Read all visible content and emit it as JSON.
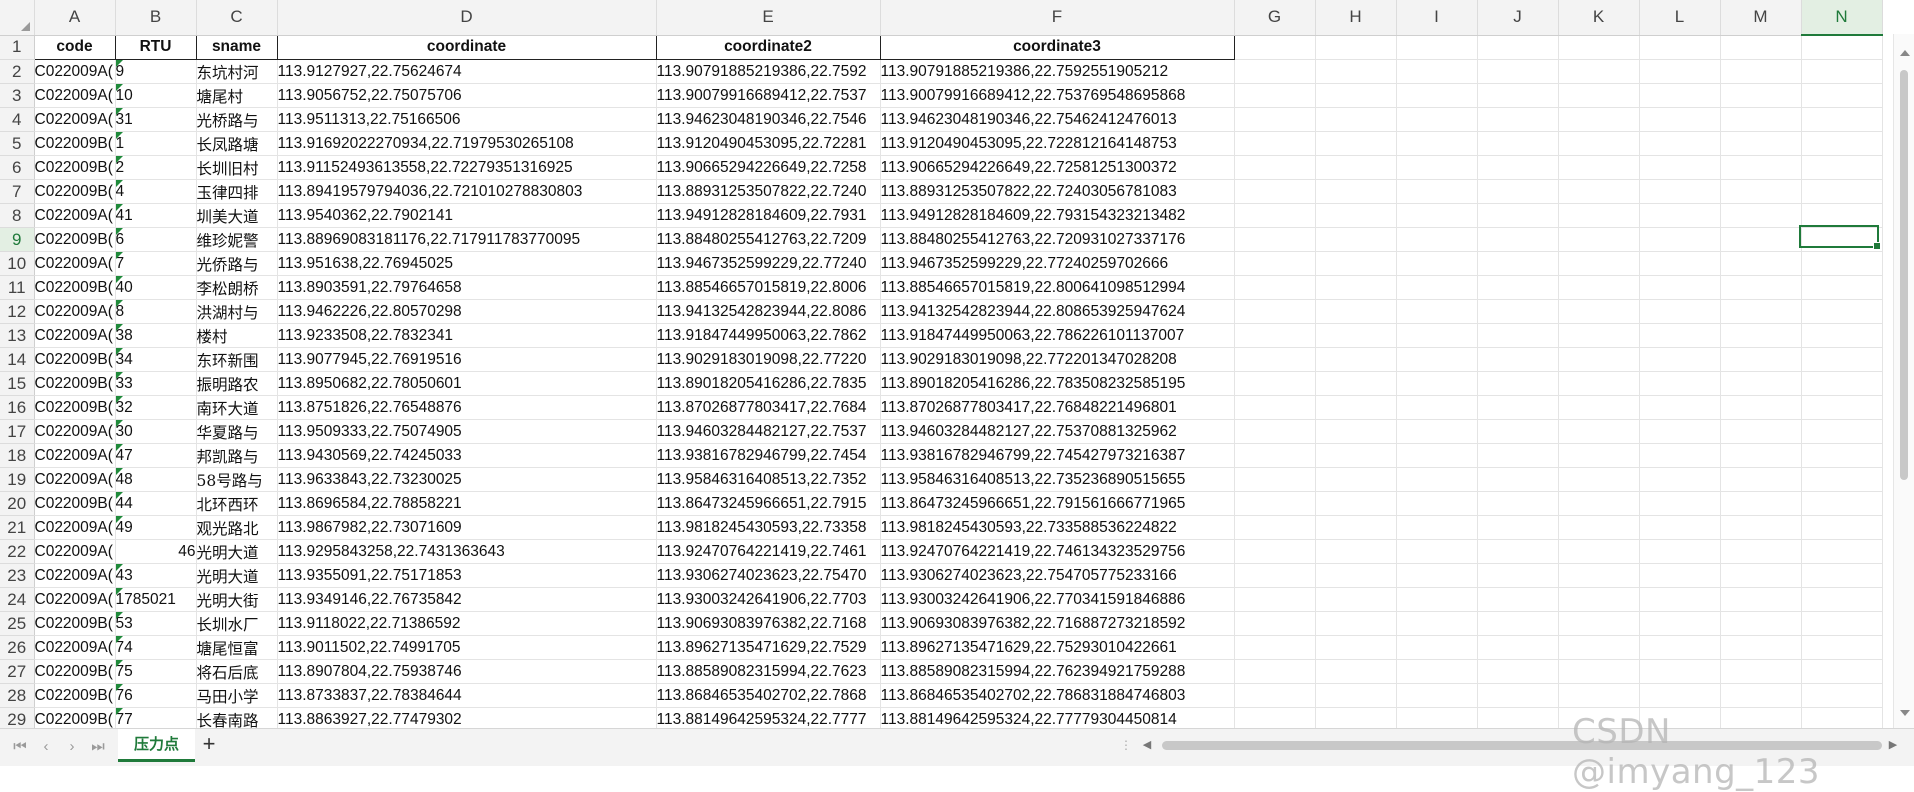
{
  "columns": [
    "A",
    "B",
    "C",
    "D",
    "E",
    "F",
    "G",
    "H",
    "I",
    "J",
    "K",
    "L",
    "M",
    "N"
  ],
  "selected_column": "N",
  "selected_row": "9",
  "header_row": {
    "row": "1",
    "cells": [
      "code",
      "RTU",
      "sname",
      "coordinate",
      "coordinate2",
      "coordinate3"
    ]
  },
  "rows": [
    {
      "row": "2",
      "a": "C022009A(",
      "b": "9",
      "c": "东坑村河",
      "d": "113.9127927,22.75624674",
      "e": "113.90791885219386,22.7592",
      "f": "113.90791885219386,22.7592551905212"
    },
    {
      "row": "3",
      "a": "C022009A(",
      "b": "10",
      "c": "塘尾村",
      "d": "113.9056752,22.75075706",
      "e": "113.90079916689412,22.7537",
      "f": "113.90079916689412,22.753769548695868"
    },
    {
      "row": "4",
      "a": "C022009A(",
      "b": "31",
      "c": "光桥路与",
      "d": "113.9511313,22.75166506",
      "e": "113.94623048190346,22.7546",
      "f": "113.94623048190346,22.75462412476013"
    },
    {
      "row": "5",
      "a": "C022009B(",
      "b": "1",
      "c": "长凤路塘",
      "d": "113.91692022270934,22.71979530265108",
      "e": "113.9120490453095,22.72281",
      "f": "113.9120490453095,22.722812164148753"
    },
    {
      "row": "6",
      "a": "C022009B(",
      "b": "2",
      "c": "长圳旧村",
      "d": "113.91152493613558,22.72279351316925",
      "e": "113.90665294226649,22.7258",
      "f": "113.90665294226649,22.72581251300372"
    },
    {
      "row": "7",
      "a": "C022009B(",
      "b": "4",
      "c": "玉律四排",
      "d": "113.89419579794036,22.721010278830803",
      "e": "113.88931253507822,22.7240",
      "f": "113.88931253507822,22.72403056781083"
    },
    {
      "row": "8",
      "a": "C022009A(",
      "b": "41",
      "c": "圳美大道",
      "d": "113.9540362,22.7902141",
      "e": "113.94912828184609,22.7931",
      "f": "113.94912828184609,22.793154323213482"
    },
    {
      "row": "9",
      "a": "C022009B(",
      "b": "6",
      "c": "维珍妮警",
      "d": "113.88969083181176,22.717911783770095",
      "e": "113.88480255412763,22.7209",
      "f": "113.88480255412763,22.720931027337176"
    },
    {
      "row": "10",
      "a": "C022009A(",
      "b": "7",
      "c": "光侨路与",
      "d": "113.951638,22.76945025",
      "e": "113.9467352599229,22.77240",
      "f": "113.9467352599229,22.77240259702666"
    },
    {
      "row": "11",
      "a": "C022009B(",
      "b": "40",
      "c": "李松朗桥",
      "d": "113.8903591,22.79764658",
      "e": "113.88546657015819,22.8006",
      "f": "113.88546657015819,22.800641098512994"
    },
    {
      "row": "12",
      "a": "C022009A(",
      "b": "8",
      "c": "洪湖村与",
      "d": "113.9462226,22.80570298",
      "e": "113.94132542823944,22.8086",
      "f": "113.94132542823944,22.808653925947624"
    },
    {
      "row": "13",
      "a": "C022009A(",
      "b": "38",
      "c": "楼村",
      "d": "113.9233508,22.7832341",
      "e": "113.91847449950063,22.7862",
      "f": "113.91847449950063,22.786226101137007"
    },
    {
      "row": "14",
      "a": "C022009B(",
      "b": "34",
      "c": "东环新围",
      "d": "113.9077945,22.76919516",
      "e": "113.9029183019098,22.77220",
      "f": "113.9029183019098,22.772201347028208"
    },
    {
      "row": "15",
      "a": "C022009B(",
      "b": "33",
      "c": "振明路农",
      "d": "113.8950682,22.78050601",
      "e": "113.89018205416286,22.7835",
      "f": "113.89018205416286,22.783508232585195"
    },
    {
      "row": "16",
      "a": "C022009B(",
      "b": "32",
      "c": "南环大道",
      "d": "113.8751826,22.76548876",
      "e": "113.87026877803417,22.7684",
      "f": "113.87026877803417,22.76848221496801"
    },
    {
      "row": "17",
      "a": "C022009A(",
      "b": "30",
      "c": "华夏路与",
      "d": "113.9509333,22.75074905",
      "e": "113.94603284482127,22.7537",
      "f": "113.94603284482127,22.75370881325962"
    },
    {
      "row": "18",
      "a": "C022009A(",
      "b": "47",
      "c": "邦凯路与",
      "d": "113.9430569,22.74245033",
      "e": "113.93816782946799,22.7454",
      "f": "113.93816782946799,22.745427973216387"
    },
    {
      "row": "19",
      "a": "C022009A(",
      "b": "48",
      "c": "58号路与",
      "d": "113.9633843,22.73230025",
      "e": "113.95846316408513,22.7352",
      "f": "113.95846316408513,22.735236890515655"
    },
    {
      "row": "20",
      "a": "C022009B(",
      "b": "44",
      "c": "北环西环",
      "d": "113.8696584,22.78858221",
      "e": "113.86473245966651,22.7915",
      "f": "113.86473245966651,22.79156166677196​5"
    },
    {
      "row": "21",
      "a": "C022009A(",
      "b": "49",
      "c": "观光路北",
      "d": "113.9867982,22.73071609",
      "e": "113.9818245430593,22.73358",
      "f": "113.9818245430593,22.733588536224822"
    },
    {
      "row": "22",
      "a": "C022009A(",
      "b": "46",
      "c": "光明大道",
      "d": "113.9295843258,22.7431363643",
      "e": "113.92470764221419,22.7461",
      "f": "113.92470764221419,22.746134323529756"
    },
    {
      "row": "23",
      "a": "C022009A(",
      "b": "43",
      "c": "光明大道",
      "d": "113.9355091,22.75171853",
      "e": "113.9306274023623,22.75470",
      "f": "113.9306274023623,22.754705775233166"
    },
    {
      "row": "24",
      "a": "C022009A(",
      "b": "1785021",
      "c": "光明大街",
      "d": "113.9349146,22.76735842",
      "e": "113.93003242641906,22.7703",
      "f": "113.93003242641906,22.770341591846886"
    },
    {
      "row": "25",
      "a": "C022009B(",
      "b": "53",
      "c": "长圳水厂",
      "d": "113.9118022,22.71386592",
      "e": "113.90693083976382,22.7168",
      "f": "113.90693083976382,22.716887273218592"
    },
    {
      "row": "26",
      "a": "C022009A(",
      "b": "74",
      "c": "塘尾恒富",
      "d": "113.9011502,22.74991705",
      "e": "113.89627135471629,22.7529",
      "f": "113.89627135471629,22.75293010422661"
    },
    {
      "row": "27",
      "a": "C022009B(",
      "b": "75",
      "c": "将石后底",
      "d": "113.8907804,22.75938746",
      "e": "113.88589082315994,22.7623",
      "f": "113.88589082315994,22.762394921759288"
    },
    {
      "row": "28",
      "a": "C022009B(",
      "b": "76",
      "c": "马田小学",
      "d": "113.8733837,22.78384644",
      "e": "113.86846535402702,22.7868",
      "f": "113.86846535402702,22.786831884746803"
    },
    {
      "row": "29",
      "a": "C022009B(",
      "b": "77",
      "c": "长春南路",
      "d": "113.8863927,22.77479302",
      "e": "113.88149642595324,22.7777",
      "f": "113.88149642595324,22.77779304450814"
    }
  ],
  "sheet_tab": "压力点",
  "add_tab_symbol": "+",
  "watermark": "CSDN @imyang_123",
  "colors": {
    "accent": "#1f7a3a",
    "header_bg": "#f3f3f3",
    "gridline": "#e4e4e4"
  }
}
